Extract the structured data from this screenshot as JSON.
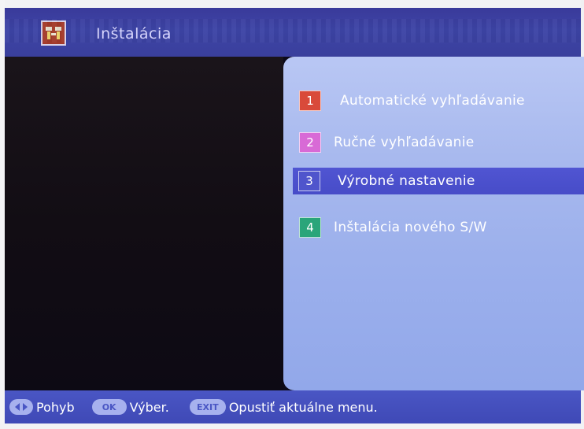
{
  "header": {
    "title": "Inštalácia",
    "icon": "installation-icon"
  },
  "menu": {
    "items": [
      {
        "number": "1",
        "label": "Automatické vyhľadávanie",
        "color": "#d94a3a",
        "selected": false
      },
      {
        "number": "2",
        "label": "Ručné vyhľadávanie",
        "color": "#d86ad6",
        "selected": false
      },
      {
        "number": "3",
        "label": "Výrobné nastavenie",
        "color": "#4f55cc",
        "selected": true
      },
      {
        "number": "4",
        "label": "Inštalácia nového S/W",
        "color": "#2aa57a",
        "selected": false
      }
    ]
  },
  "footer": {
    "hints": [
      {
        "key_icon": "navigate-key-icon",
        "key_label": "",
        "text": "Pohyb"
      },
      {
        "key_icon": "ok-key-icon",
        "key_label": "OK",
        "text": "Výber."
      },
      {
        "key_icon": "exit-key-icon",
        "key_label": "EXIT",
        "text": "Opustiť aktuálne menu."
      }
    ]
  },
  "colors": {
    "header_bg": "#3d44a6",
    "panel_bg": "#a8b9ee",
    "selection_bg": "#4f55cc",
    "footer_bg": "#4450bc"
  }
}
